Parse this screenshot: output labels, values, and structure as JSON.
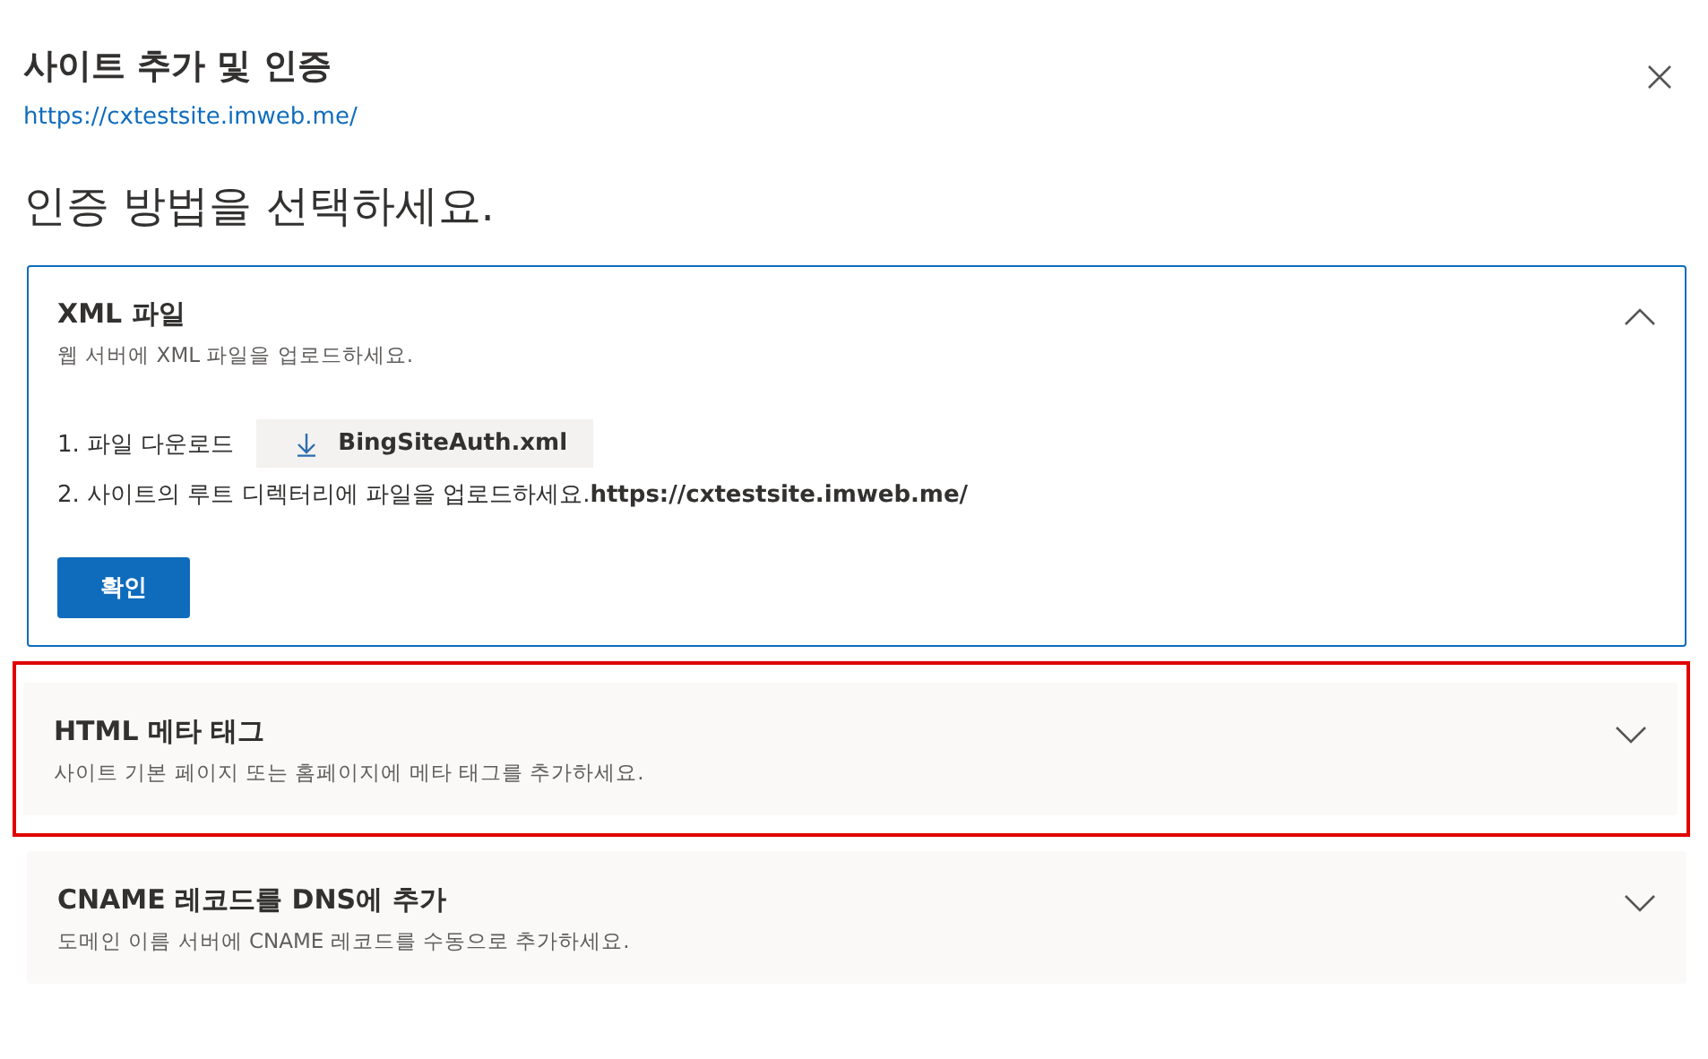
{
  "dialog": {
    "title": "사이트 추가 및 인증",
    "url": "https://cxtestsite.imweb.me/"
  },
  "heading": "인증 방법을 선택하세요.",
  "methods": [
    {
      "title": "XML 파일",
      "description": "웹 서버에 XML 파일을 업로드하세요.",
      "expanded": true,
      "highlighted": false,
      "steps": [
        {
          "kind": "download",
          "label": "1. 파일 다운로드",
          "file": "BingSiteAuth.xml"
        },
        {
          "kind": "text",
          "label": "2. 사이트의 루트 디렉터리에 파일을 업로드하세요.**https://cxtestsite.imweb.me/**"
        }
      ],
      "button": "확인"
    },
    {
      "title": "HTML 메타 태그",
      "description": "사이트 기본 페이지 또는 홈페이지에 메타 태그를 추가하세요.",
      "expanded": false,
      "highlighted": true
    },
    {
      "title": "CNAME 레코드를 DNS에 추가",
      "description": "도메인 이름 서버에 CNAME 레코드를 수동으로 추가하세요.",
      "expanded": false,
      "highlighted": false
    }
  ]
}
